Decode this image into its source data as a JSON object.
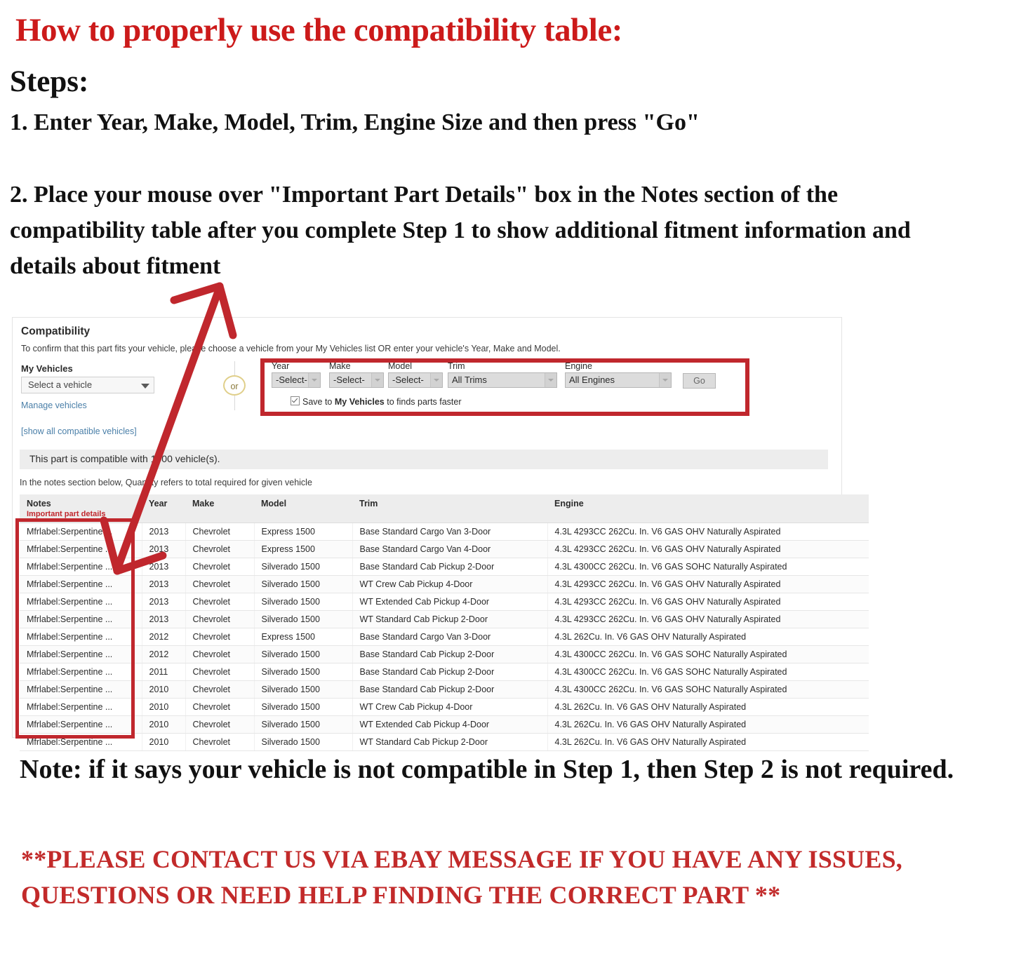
{
  "headline": "How to properly use the compatibility table:",
  "steps_label": "Steps:",
  "step1": "1. Enter Year, Make, Model, Trim, Engine Size and then press \"Go\"",
  "step2": "2. Place your mouse over \"Important Part Details\" box in the Notes section of the compatibility table after you complete Step 1 to show additional fitment information and details about fitment",
  "note": "Note: if it says your vehicle is not compatible in Step 1, then Step 2 is not required.",
  "contact": "**PLEASE CONTACT US VIA EBAY MESSAGE IF YOU HAVE ANY ISSUES, QUESTIONS OR NEED HELP FINDING THE CORRECT PART **",
  "colors": {
    "headline_red": "#cc1a1a",
    "contact_red": "#c22a2a",
    "highlight_red": "#c0272d",
    "link_blue": "#4a7fa8",
    "banner_gray": "#ededed"
  },
  "panel": {
    "title": "Compatibility",
    "subtitle": "To confirm that this part fits your vehicle, please choose a vehicle from your My Vehicles list OR enter your vehicle's Year, Make and Model.",
    "my_vehicles_label": "My Vehicles",
    "vehicle_select_value": "Select a vehicle",
    "manage_vehicles_link": "Manage vehicles",
    "show_all_link": "[show all compatible vehicles]",
    "or_divider": "or",
    "fields": [
      {
        "label": "Year",
        "value": "-Select-"
      },
      {
        "label": "Make",
        "value": "-Select-"
      },
      {
        "label": "Model",
        "value": "-Select-"
      },
      {
        "label": "Trim",
        "value": "All Trims"
      },
      {
        "label": "Engine",
        "value": "All Engines"
      }
    ],
    "go_label": "Go",
    "save_prefix": "Save to ",
    "save_bold": "My Vehicles",
    "save_suffix": " to finds parts faster",
    "save_checked": true,
    "compat_banner": "This part is compatible with 1000 vehicle(s).",
    "qty_note": "In the notes section below, Quantity refers to total required for given vehicle"
  },
  "table": {
    "headers": {
      "notes": "Notes",
      "notes_sub": "Important part details",
      "year": "Year",
      "make": "Make",
      "model": "Model",
      "trim": "Trim",
      "engine": "Engine"
    },
    "rows": [
      {
        "notes": "Mfrlabel:Serpentine ...",
        "year": "2013",
        "make": "Chevrolet",
        "model": "Express 1500",
        "trim": "Base Standard Cargo Van 3-Door",
        "engine": "4.3L 4293CC 262Cu. In. V6 GAS OHV Naturally Aspirated"
      },
      {
        "notes": "Mfrlabel:Serpentine ...",
        "year": "2013",
        "make": "Chevrolet",
        "model": "Express 1500",
        "trim": "Base Standard Cargo Van 4-Door",
        "engine": "4.3L 4293CC 262Cu. In. V6 GAS OHV Naturally Aspirated"
      },
      {
        "notes": "Mfrlabel:Serpentine ...",
        "year": "2013",
        "make": "Chevrolet",
        "model": "Silverado 1500",
        "trim": "Base Standard Cab Pickup 2-Door",
        "engine": "4.3L 4300CC 262Cu. In. V6 GAS SOHC Naturally Aspirated"
      },
      {
        "notes": "Mfrlabel:Serpentine ...",
        "year": "2013",
        "make": "Chevrolet",
        "model": "Silverado 1500",
        "trim": "WT Crew Cab Pickup 4-Door",
        "engine": "4.3L 4293CC 262Cu. In. V6 GAS OHV Naturally Aspirated"
      },
      {
        "notes": "Mfrlabel:Serpentine ...",
        "year": "2013",
        "make": "Chevrolet",
        "model": "Silverado 1500",
        "trim": "WT Extended Cab Pickup 4-Door",
        "engine": "4.3L 4293CC 262Cu. In. V6 GAS OHV Naturally Aspirated"
      },
      {
        "notes": "Mfrlabel:Serpentine ...",
        "year": "2013",
        "make": "Chevrolet",
        "model": "Silverado 1500",
        "trim": "WT Standard Cab Pickup 2-Door",
        "engine": "4.3L 4293CC 262Cu. In. V6 GAS OHV Naturally Aspirated"
      },
      {
        "notes": "Mfrlabel:Serpentine ...",
        "year": "2012",
        "make": "Chevrolet",
        "model": "Express 1500",
        "trim": "Base Standard Cargo Van 3-Door",
        "engine": "4.3L 262Cu. In. V6 GAS OHV Naturally Aspirated"
      },
      {
        "notes": "Mfrlabel:Serpentine ...",
        "year": "2012",
        "make": "Chevrolet",
        "model": "Silverado 1500",
        "trim": "Base Standard Cab Pickup 2-Door",
        "engine": "4.3L 4300CC 262Cu. In. V6 GAS SOHC Naturally Aspirated"
      },
      {
        "notes": "Mfrlabel:Serpentine ...",
        "year": "2011",
        "make": "Chevrolet",
        "model": "Silverado 1500",
        "trim": "Base Standard Cab Pickup 2-Door",
        "engine": "4.3L 4300CC 262Cu. In. V6 GAS SOHC Naturally Aspirated"
      },
      {
        "notes": "Mfrlabel:Serpentine ...",
        "year": "2010",
        "make": "Chevrolet",
        "model": "Silverado 1500",
        "trim": "Base Standard Cab Pickup 2-Door",
        "engine": "4.3L 4300CC 262Cu. In. V6 GAS SOHC Naturally Aspirated"
      },
      {
        "notes": "Mfrlabel:Serpentine ...",
        "year": "2010",
        "make": "Chevrolet",
        "model": "Silverado 1500",
        "trim": "WT Crew Cab Pickup 4-Door",
        "engine": "4.3L 262Cu. In. V6 GAS OHV Naturally Aspirated"
      },
      {
        "notes": "Mfrlabel:Serpentine ...",
        "year": "2010",
        "make": "Chevrolet",
        "model": "Silverado 1500",
        "trim": "WT Extended Cab Pickup 4-Door",
        "engine": "4.3L 262Cu. In. V6 GAS OHV Naturally Aspirated"
      },
      {
        "notes": "Mfrlabel:Serpentine ...",
        "year": "2010",
        "make": "Chevrolet",
        "model": "Silverado 1500",
        "trim": "WT Standard Cab Pickup 2-Door",
        "engine": "4.3L 262Cu. In. V6 GAS OHV Naturally Aspirated"
      }
    ]
  }
}
